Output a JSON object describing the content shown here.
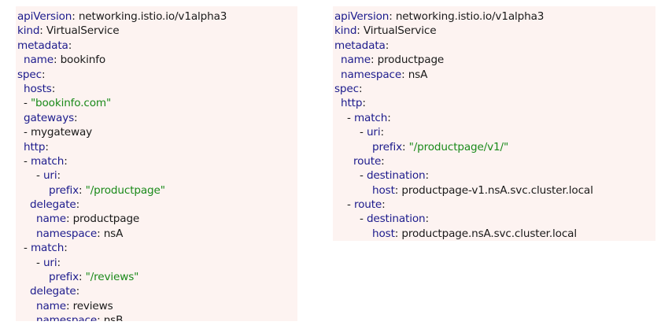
{
  "colors": {
    "panel_background": "#fdf3f1",
    "key": "#1c1b8c",
    "value": "#1a1a1a",
    "string": "#1a8a1a"
  },
  "left_yaml": {
    "lines": [
      {
        "indent": 0,
        "dash": false,
        "key": "apiVersion",
        "value": "networking.istio.io/v1alpha3",
        "string": false
      },
      {
        "indent": 0,
        "dash": false,
        "key": "kind",
        "value": "VirtualService",
        "string": false
      },
      {
        "indent": 0,
        "dash": false,
        "key": "metadata",
        "value": "",
        "string": false
      },
      {
        "indent": 1,
        "dash": false,
        "key": "name",
        "value": "bookinfo",
        "string": false
      },
      {
        "indent": 0,
        "dash": false,
        "key": "spec",
        "value": "",
        "string": false
      },
      {
        "indent": 1,
        "dash": false,
        "key": "hosts",
        "value": "",
        "string": false
      },
      {
        "indent": 1,
        "dash": true,
        "key": "",
        "value": "\"bookinfo.com\"",
        "string": true
      },
      {
        "indent": 1,
        "dash": false,
        "key": "gateways",
        "value": "",
        "string": false
      },
      {
        "indent": 1,
        "dash": true,
        "key": "",
        "value": "mygateway",
        "string": false
      },
      {
        "indent": 1,
        "dash": false,
        "key": "http",
        "value": "",
        "string": false
      },
      {
        "indent": 1,
        "dash": true,
        "key": "match",
        "value": "",
        "string": false
      },
      {
        "indent": 3,
        "dash": true,
        "key": "uri",
        "value": "",
        "string": false
      },
      {
        "indent": 5,
        "dash": false,
        "key": "prefix",
        "value": "\"/productpage\"",
        "string": true
      },
      {
        "indent": 2,
        "dash": false,
        "key": "delegate",
        "value": "",
        "string": false
      },
      {
        "indent": 3,
        "dash": false,
        "key": "name",
        "value": "productpage",
        "string": false
      },
      {
        "indent": 3,
        "dash": false,
        "key": "namespace",
        "value": "nsA",
        "string": false
      },
      {
        "indent": 1,
        "dash": true,
        "key": "match",
        "value": "",
        "string": false
      },
      {
        "indent": 3,
        "dash": true,
        "key": "uri",
        "value": "",
        "string": false
      },
      {
        "indent": 5,
        "dash": false,
        "key": "prefix",
        "value": "\"/reviews\"",
        "string": true
      },
      {
        "indent": 2,
        "dash": false,
        "key": "delegate",
        "value": "",
        "string": false
      },
      {
        "indent": 3,
        "dash": false,
        "key": "name",
        "value": "reviews",
        "string": false
      },
      {
        "indent": 3,
        "dash": false,
        "key": "namespace",
        "value": "nsB",
        "string": false
      }
    ]
  },
  "right_yaml": {
    "lines": [
      {
        "indent": 0,
        "dash": false,
        "key": "apiVersion",
        "value": "networking.istio.io/v1alpha3",
        "string": false
      },
      {
        "indent": 0,
        "dash": false,
        "key": "kind",
        "value": "VirtualService",
        "string": false
      },
      {
        "indent": 0,
        "dash": false,
        "key": "metadata",
        "value": "",
        "string": false
      },
      {
        "indent": 1,
        "dash": false,
        "key": "name",
        "value": "productpage",
        "string": false
      },
      {
        "indent": 1,
        "dash": false,
        "key": "namespace",
        "value": "nsA",
        "string": false
      },
      {
        "indent": 0,
        "dash": false,
        "key": "spec",
        "value": "",
        "string": false
      },
      {
        "indent": 1,
        "dash": false,
        "key": "http",
        "value": "",
        "string": false
      },
      {
        "indent": 2,
        "dash": true,
        "key": "match",
        "value": "",
        "string": false
      },
      {
        "indent": 4,
        "dash": true,
        "key": "uri",
        "value": "",
        "string": false
      },
      {
        "indent": 6,
        "dash": false,
        "key": "prefix",
        "value": "\"/productpage/v1/\"",
        "string": true
      },
      {
        "indent": 3,
        "dash": false,
        "key": "route",
        "value": "",
        "string": false
      },
      {
        "indent": 4,
        "dash": true,
        "key": "destination",
        "value": "",
        "string": false
      },
      {
        "indent": 6,
        "dash": false,
        "key": "host",
        "value": "productpage-v1.nsA.svc.cluster.local",
        "string": false
      },
      {
        "indent": 2,
        "dash": true,
        "key": "route",
        "value": "",
        "string": false
      },
      {
        "indent": 4,
        "dash": true,
        "key": "destination",
        "value": "",
        "string": false
      },
      {
        "indent": 6,
        "dash": false,
        "key": "host",
        "value": "productpage.nsA.svc.cluster.local",
        "string": false
      }
    ]
  }
}
